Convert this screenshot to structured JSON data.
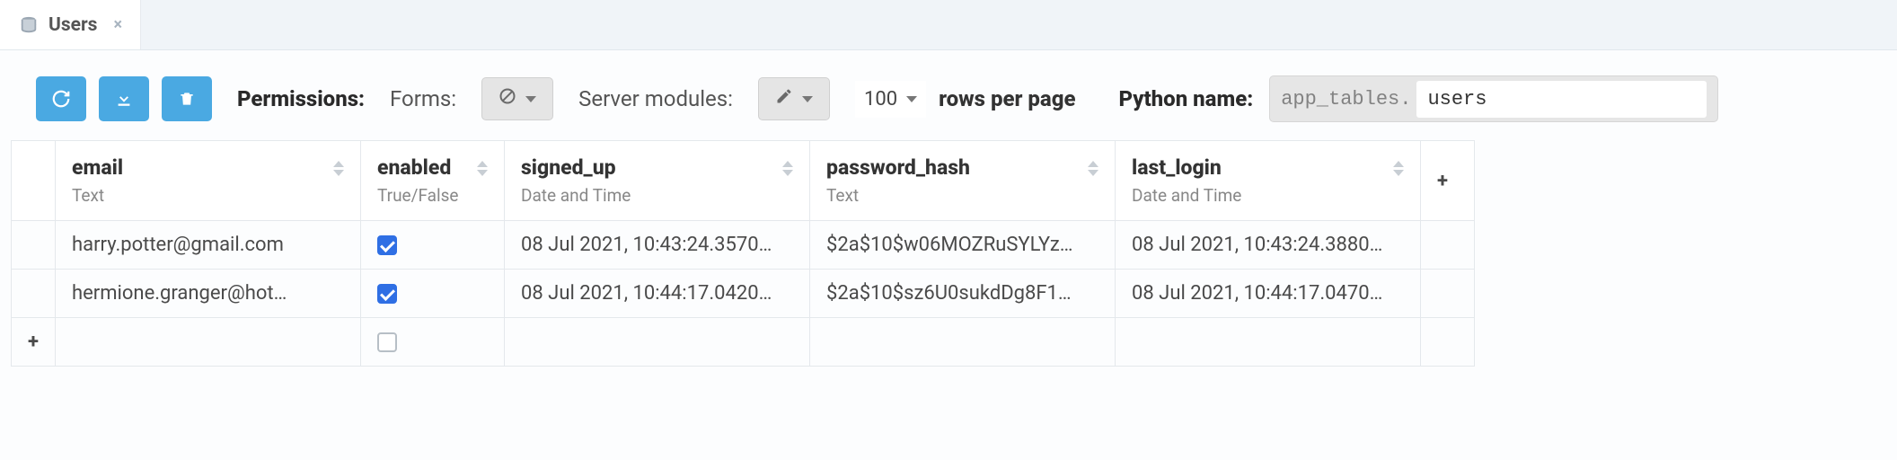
{
  "tab": {
    "title": "Users"
  },
  "toolbar": {
    "permissions_label": "Permissions:",
    "forms_label": "Forms:",
    "server_modules_label": "Server modules:",
    "rows_per_page_value": "100",
    "rows_per_page_label": "rows per page",
    "python_name_label": "Python name:",
    "python_name_prefix": "app_tables.",
    "python_name_value": "users"
  },
  "columns": [
    {
      "name": "email",
      "type": "Text"
    },
    {
      "name": "enabled",
      "type": "True/False"
    },
    {
      "name": "signed_up",
      "type": "Date and Time"
    },
    {
      "name": "password_hash",
      "type": "Text"
    },
    {
      "name": "last_login",
      "type": "Date and Time"
    }
  ],
  "rows": [
    {
      "email": "harry.potter@gmail.com",
      "enabled": true,
      "signed_up": "08 Jul 2021, 10:43:24.3570…",
      "password_hash": "$2a$10$w06MOZRuSYLYz…",
      "last_login": "08 Jul 2021, 10:43:24.3880…"
    },
    {
      "email": "hermione.granger@hot…",
      "enabled": true,
      "signed_up": "08 Jul 2021, 10:44:17.0420…",
      "password_hash": "$2a$10$sz6U0sukdDg8F1…",
      "last_login": "08 Jul 2021, 10:44:17.0470…"
    }
  ]
}
